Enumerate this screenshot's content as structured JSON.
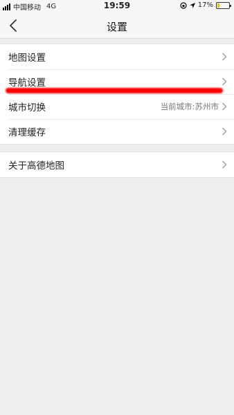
{
  "status": {
    "carrier": "中国移动",
    "network": "4G",
    "time": "19:59",
    "battery_percent": "17%",
    "battery_level": 0.17,
    "battery_color": "#f2c200"
  },
  "nav": {
    "title": "设置"
  },
  "groups": [
    {
      "items": [
        {
          "label": "地图设置"
        },
        {
          "label": "导航设置"
        },
        {
          "label": "城市切换",
          "value": "当前城市:苏州市"
        },
        {
          "label": "清理缓存"
        }
      ]
    },
    {
      "items": [
        {
          "label": "关于高德地图"
        }
      ]
    }
  ],
  "colors": {
    "background": "#efefef",
    "annotation_stroke": "#ff0000"
  }
}
